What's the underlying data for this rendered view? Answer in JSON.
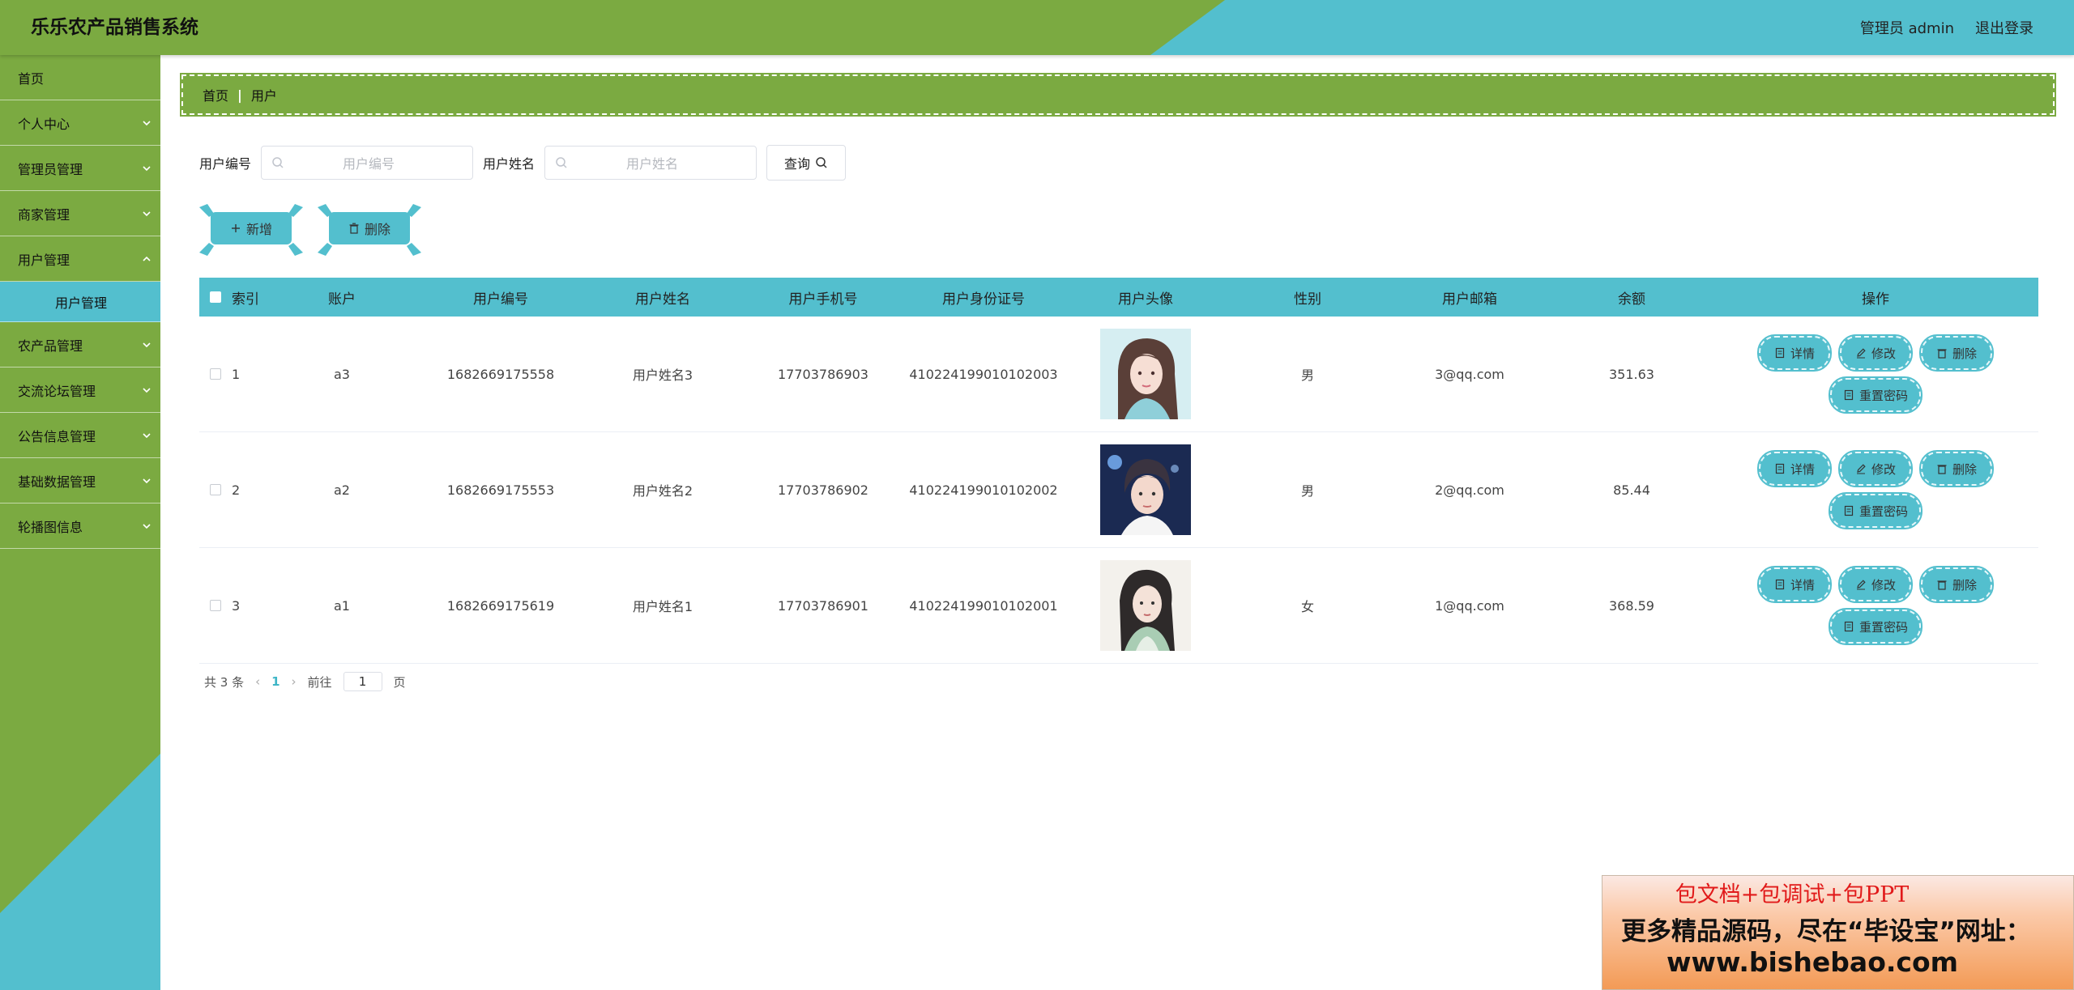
{
  "header": {
    "title": "乐乐农产品销售系统",
    "user_label": "管理员 admin",
    "logout_label": "退出登录",
    "colors": {
      "green": "#7baa41",
      "teal": "#53bfce"
    }
  },
  "sidebar": {
    "items": [
      {
        "label": "首页",
        "expandable": false
      },
      {
        "label": "个人中心",
        "expandable": true
      },
      {
        "label": "管理员管理",
        "expandable": true
      },
      {
        "label": "商家管理",
        "expandable": true
      },
      {
        "label": "用户管理",
        "expandable": true,
        "sub": "用户管理"
      },
      {
        "label": "农产品管理",
        "expandable": true
      },
      {
        "label": "交流论坛管理",
        "expandable": true
      },
      {
        "label": "公告信息管理",
        "expandable": true
      },
      {
        "label": "基础数据管理",
        "expandable": true
      },
      {
        "label": "轮播图信息",
        "expandable": true
      }
    ]
  },
  "breadcrumb": {
    "home": "首页",
    "separator": "|",
    "current": "用户"
  },
  "search": {
    "code_label": "用户编号",
    "code_placeholder": "用户编号",
    "name_label": "用户姓名",
    "name_placeholder": "用户姓名",
    "query_label": "查询"
  },
  "actions": {
    "add_label": "新增",
    "delete_label": "删除"
  },
  "table": {
    "headers": [
      "索引",
      "账户",
      "用户编号",
      "用户姓名",
      "用户手机号",
      "用户身份证号",
      "用户头像",
      "性别",
      "用户邮箱",
      "余额",
      "操作"
    ],
    "rows": [
      {
        "index": "1",
        "account": "a3",
        "code": "1682669175558",
        "name": "用户姓名3",
        "phone": "17703786903",
        "id_card": "410224199010102003",
        "avatar": "female-avatar-1",
        "sex": "男",
        "email": "3@qq.com",
        "balance": "351.63"
      },
      {
        "index": "2",
        "account": "a2",
        "code": "1682669175553",
        "name": "用户姓名2",
        "phone": "17703786902",
        "id_card": "410224199010102002",
        "avatar": "male-avatar",
        "sex": "男",
        "email": "2@qq.com",
        "balance": "85.44"
      },
      {
        "index": "3",
        "account": "a1",
        "code": "1682669175619",
        "name": "用户姓名1",
        "phone": "17703786901",
        "id_card": "410224199010102001",
        "avatar": "female-avatar-2",
        "sex": "女",
        "email": "1@qq.com",
        "balance": "368.59"
      }
    ],
    "row_actions": {
      "detail": "详情",
      "edit": "修改",
      "delete": "删除",
      "reset_password": "重置密码"
    }
  },
  "pagination": {
    "total": "共 3 条",
    "prev": "‹",
    "current_page": "1",
    "next": "›",
    "goto_label": "前往",
    "goto_value": "1",
    "page_suffix": "页"
  },
  "watermark": {
    "line1": "包文档+包调试+包PPT",
    "line2": "更多精品源码，尽在“毕设宝”网址：",
    "line3": "www.bishebao.com"
  }
}
